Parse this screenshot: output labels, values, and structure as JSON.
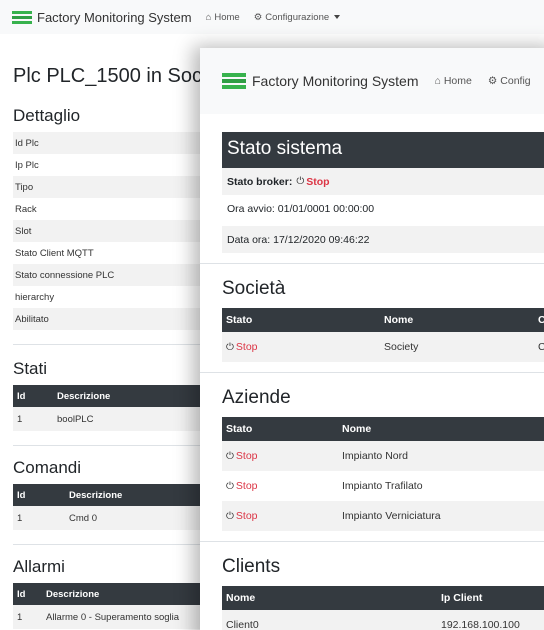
{
  "app": {
    "brand": "Factory Monitoring System",
    "nav_home": "Home",
    "nav_config": "Configurazione",
    "colors": {
      "dark": "#343a40",
      "stop": "#dc3545",
      "navbar": "#f8f9fa",
      "brand_green": "#37b24d"
    }
  },
  "back": {
    "title": "Plc PLC_1500 in Soci",
    "dettaglio_heading": "Dettaglio",
    "dettaglio_rows": [
      "Id Plc",
      "Ip Plc",
      "Tipo",
      "Rack",
      "Slot",
      "Stato Client MQTT",
      "Stato connessione PLC",
      "hierarchy",
      "Abilitato"
    ],
    "stati_heading": "Stati",
    "stati_columns": [
      "Id",
      "Descrizione"
    ],
    "stati_rows": [
      [
        "1",
        "boolPLC"
      ]
    ],
    "comandi_heading": "Comandi",
    "comandi_columns": [
      "Id",
      "Descrizione"
    ],
    "comandi_rows": [
      [
        "1",
        "Cmd 0"
      ]
    ],
    "allarmi_heading": "Allarmi",
    "allarmi_columns": [
      "Id",
      "Descrizione"
    ],
    "allarmi_rows": [
      [
        "1",
        "Allarme 0 - Superamento soglia"
      ]
    ]
  },
  "front": {
    "nav_config_partial": "Config",
    "stato_title": "Stato sistema",
    "broker_label": "Stato broker:",
    "broker_status": "Stop",
    "ora_avvio": "Ora avvio: 01/01/0001 00:00:00",
    "data_ora": "Data ora: 17/12/2020 09:46:22",
    "societa_heading": "Società",
    "societa_columns": [
      "Stato",
      "Nome",
      "C"
    ],
    "societa_rows": [
      {
        "stato": "Stop",
        "nome": "Society",
        "extra": "C"
      }
    ],
    "aziende_heading": "Aziende",
    "aziende_columns": [
      "Stato",
      "Nome"
    ],
    "aziende_rows": [
      {
        "stato": "Stop",
        "nome": "Impianto Nord"
      },
      {
        "stato": "Stop",
        "nome": "Impianto Trafilato"
      },
      {
        "stato": "Stop",
        "nome": "Impianto Verniciatura"
      }
    ],
    "clients_heading": "Clients",
    "clients_columns": [
      "Nome",
      "Ip Client"
    ],
    "clients_rows": [
      {
        "nome": "Client0",
        "ip": "192.168.100.100"
      }
    ]
  }
}
